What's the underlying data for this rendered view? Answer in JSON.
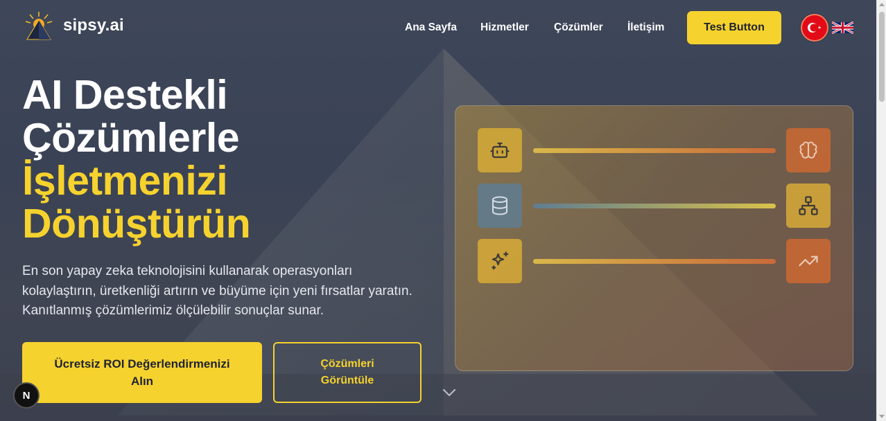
{
  "brand": {
    "name": "sipsy.ai"
  },
  "nav": {
    "items": [
      {
        "label": "Ana Sayfa"
      },
      {
        "label": "Hizmetler"
      },
      {
        "label": "Çözümler"
      },
      {
        "label": "İletişim"
      }
    ],
    "cta_label": "Test Button"
  },
  "languages": [
    {
      "code": "tr",
      "icon": "turkey-flag-icon",
      "active": true
    },
    {
      "code": "en",
      "icon": "uk-flag-icon",
      "active": false
    }
  ],
  "hero": {
    "title_line1": "AI Destekli",
    "title_line2": "Çözümlerle",
    "title_line3": "İşletmenizi",
    "title_line4": "Dönüştürün",
    "subtitle": "En son yapay zeka teknolojisini kullanarak operasyonları kolaylaştırın, üretkenliği artırın ve büyüme için yeni fırsatlar yaratın. Kanıtlanmış çözümlerimiz ölçülebilir sonuçlar sunar.",
    "primary_button": "Ücretsiz ROI Değerlendirmenizi Alın",
    "secondary_button": "Çözümleri Görüntüle"
  },
  "illustration": {
    "rows": [
      {
        "left_icon": "robot-icon",
        "right_icon": "brain-icon"
      },
      {
        "left_icon": "database-icon",
        "right_icon": "network-icon"
      },
      {
        "left_icon": "sparkles-icon",
        "right_icon": "trending-up-icon"
      }
    ]
  },
  "dev_badge": {
    "label": "N"
  },
  "colors": {
    "accent": "#f6d22e",
    "background": "#3a4256",
    "orange": "#cd6932"
  }
}
